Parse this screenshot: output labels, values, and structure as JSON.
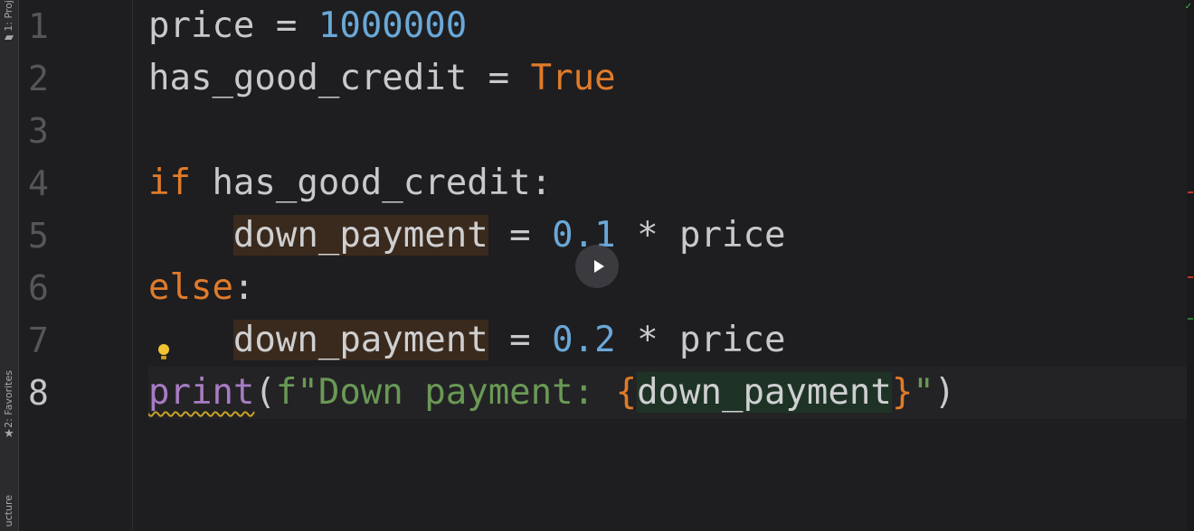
{
  "tool_windows": {
    "project_label": "1: Proj",
    "favorites_label": "2: Favorites",
    "structure_label": "ucture"
  },
  "gutter": {
    "line_numbers": [
      "1",
      "2",
      "3",
      "4",
      "5",
      "6",
      "7",
      "8"
    ],
    "current_line": "8"
  },
  "editor": {
    "line1": {
      "name": "price",
      "op": " = ",
      "value": "1000000"
    },
    "line2": {
      "name": "has_good_credit",
      "op": " = ",
      "value": "True"
    },
    "line4": {
      "kw": "if",
      "rest": " has_good_credit:"
    },
    "line5": {
      "indent": "    ",
      "var": "down_payment",
      "op": " = ",
      "num": "0.1",
      "rest": " * price"
    },
    "line6": {
      "kw": "else",
      "colon": ":"
    },
    "line7": {
      "indent": "    ",
      "var": "down_payment",
      "op": " = ",
      "num": "0.2",
      "rest": " * price"
    },
    "line8": {
      "fn": "print",
      "open_paren": "(",
      "str_start": "f\"Down payment: ",
      "brace_open": "{",
      "interp": "down_payment",
      "brace_close": "}",
      "str_end": "\"",
      "close_paren": ")"
    }
  },
  "icons": {
    "bulb": "lightbulb-icon",
    "play": "play-icon",
    "favorites_star": "star-icon",
    "project_folder": "folder-icon"
  },
  "colors": {
    "background": "#1e1e20",
    "keyword": "#e07b2a",
    "number": "#6aa8d8",
    "string": "#6a9955",
    "function": "#a77cc4"
  }
}
